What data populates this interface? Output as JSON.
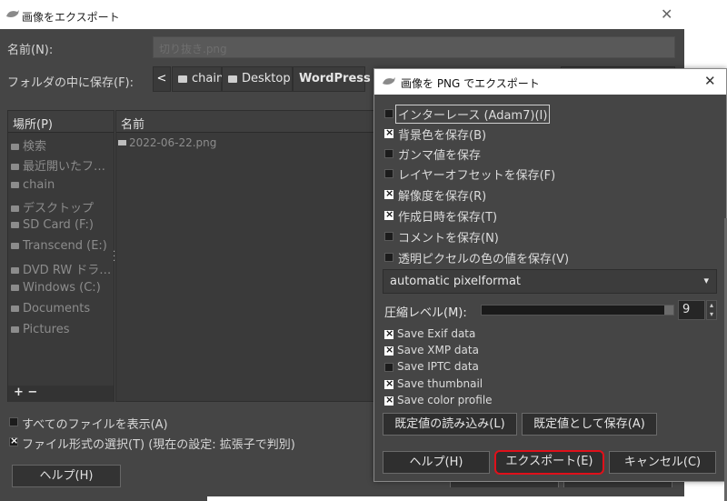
{
  "outer": {
    "title": "画像をエクスポート",
    "name_label": "名前(N):",
    "name_value": "切り抜き.png",
    "folder_label": "フォルダの中に保存(F):",
    "path_back": "<",
    "crumbs": [
      "chain",
      "Desktop",
      "WordPress"
    ],
    "places_header": "場所(P)",
    "places": [
      "検索",
      "最近開いたフ…",
      "chain",
      "デスクトップ",
      "SD Card (F:)",
      "Transcend (E:)",
      "DVD RW ドラ…",
      "Windows (C:)",
      "Documents",
      "Pictures"
    ],
    "places_footer": "+ −",
    "files_header": "名前",
    "file_name": "2022-06-22.png",
    "show_all_label": "すべてのファイルを表示(A)",
    "filetype_label": "ファイル形式の選択(T) (現在の設定: 拡張子で判別)",
    "help_label": "ヘルプ(H)"
  },
  "png": {
    "title": "画像を PNG でエクスポート",
    "options": [
      {
        "label": "インターレース (Adam7)(I)",
        "checked": false
      },
      {
        "label": "背景色を保存(B)",
        "checked": true
      },
      {
        "label": "ガンマ値を保存",
        "checked": false
      },
      {
        "label": "レイヤーオフセットを保存(F)",
        "checked": false
      },
      {
        "label": "解像度を保存(R)",
        "checked": true
      },
      {
        "label": "作成日時を保存(T)",
        "checked": true
      },
      {
        "label": "コメントを保存(N)",
        "checked": false
      },
      {
        "label": "透明ピクセルの色の値を保存(V)",
        "checked": false
      }
    ],
    "pixel_format": "automatic pixelformat",
    "compression_label": "圧縮レベル(M):",
    "compression_value": "9",
    "compression_level": 1.0,
    "metadata": [
      {
        "label": "Save Exif data",
        "checked": true
      },
      {
        "label": "Save XMP data",
        "checked": true
      },
      {
        "label": "Save IPTC data",
        "checked": false
      },
      {
        "label": "Save thumbnail",
        "checked": true
      },
      {
        "label": "Save color profile",
        "checked": true
      }
    ],
    "load_defaults": "既定値の読み込み(L)",
    "save_defaults": "既定値として保存(A)",
    "help": "ヘルプ(H)",
    "export": "エクスポート(E)",
    "cancel": "キャンセル(C)"
  },
  "colors": {
    "dialog_bg": "#454545",
    "highlight": "#e0101a"
  }
}
